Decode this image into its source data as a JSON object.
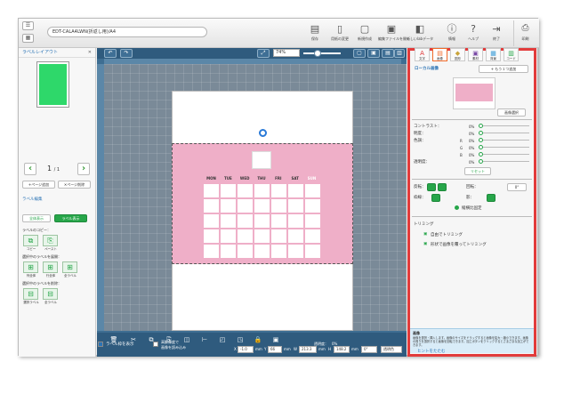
{
  "toolbar": {
    "filename": "EDT-CALA4LWN(折返し用)/A4",
    "tools": [
      {
        "name": "save",
        "label": "保存",
        "icon": "save-icon"
      },
      {
        "name": "open",
        "label": "用紙の変更",
        "icon": "page-change-icon"
      },
      {
        "name": "new",
        "label": "新規作成",
        "icon": "new-file-icon"
      },
      {
        "name": "edit-file",
        "label": "編集ファイルを開く",
        "icon": "open-file-icon"
      },
      {
        "name": "new-data",
        "label": "新しいlabデータ",
        "icon": "new-data-icon"
      },
      {
        "name": "info",
        "label": "情報",
        "icon": "info-icon"
      },
      {
        "name": "help",
        "label": "ヘルプ",
        "icon": "help-icon"
      },
      {
        "name": "exit",
        "label": "終了",
        "icon": "exit-icon"
      }
    ],
    "print_label": "印刷"
  },
  "left": {
    "title": "ラベルレイアウト",
    "page_current": "1",
    "page_total": "/ 1",
    "add_page": "+ページ追加",
    "delete_page": "✕ページ削除",
    "label_edit": "ラベル編集",
    "show_all": "全体表示",
    "show_label": "ラベル表示",
    "copy_section": "ラベルのコピー：",
    "copy": "コピー",
    "paste": "ペースト",
    "expand_section": "選択中のラベルを展開：",
    "expand_col": "列全体",
    "expand_row": "行全体",
    "expand_all": "全ラベル",
    "delete_section": "選択中のラベルを削除：",
    "delete_selected": "選択ラベル",
    "delete_all": "全ラベル"
  },
  "canvas": {
    "zoom": "74%",
    "weekdays": [
      "MON",
      "TUE",
      "WED",
      "THU",
      "FRI",
      "SAT",
      "SUN"
    ],
    "bottom": {
      "x_label": "X",
      "x_value": "-1.0",
      "y_label": "Y",
      "y_value": "66",
      "w_label": "W",
      "w_value": "213.3",
      "h_label": "H",
      "h_value": "148.2",
      "unit": "mm",
      "angle": "0°",
      "transparency_btn": "透明色",
      "show_frame": "ラベル枠を表示",
      "high_res": "高解像度で",
      "high_res2": "画像を読み込み",
      "opacity_label": "透明度：",
      "opacity_value": "0%"
    }
  },
  "right": {
    "tabs": [
      "文字",
      "画像",
      "図形",
      "素材",
      "背景",
      "コード"
    ],
    "section": "ローカル画像",
    "add_more": "+ もう１つ追加",
    "select_image": "画像選択",
    "contrast": "コントラスト：",
    "brightness": "明度：",
    "color": "色調：",
    "r": "R",
    "g": "G",
    "b": "B",
    "transparency": "透明度：",
    "zero": "0%",
    "reset": "リセット",
    "flip": "反転：",
    "rotate": "回転：",
    "rotate_value": "0°",
    "border": "枠線：",
    "shadow": "影：",
    "keep_ratio": "縦横比固定",
    "trimming": "トリミング",
    "trim_free": "自由でトリミング",
    "trim_shape": "形状で画像を覆ってトリミング",
    "hint_title": "画像",
    "hint_body": "画像を選択・挿入します。画像のサイズをドラッグすると画像を拡大・縮小できます。画像の周りを選択すると画像を回転できます。加工ボタンをクリックするとさまざまな加工ができます。",
    "hint_close": "ヒントをたたむ"
  },
  "colors": {
    "accent_green": "#27a64a",
    "highlight_red": "#e23b3b",
    "pink": "#efafc8",
    "canvas_blue": "#2f5b7e"
  }
}
